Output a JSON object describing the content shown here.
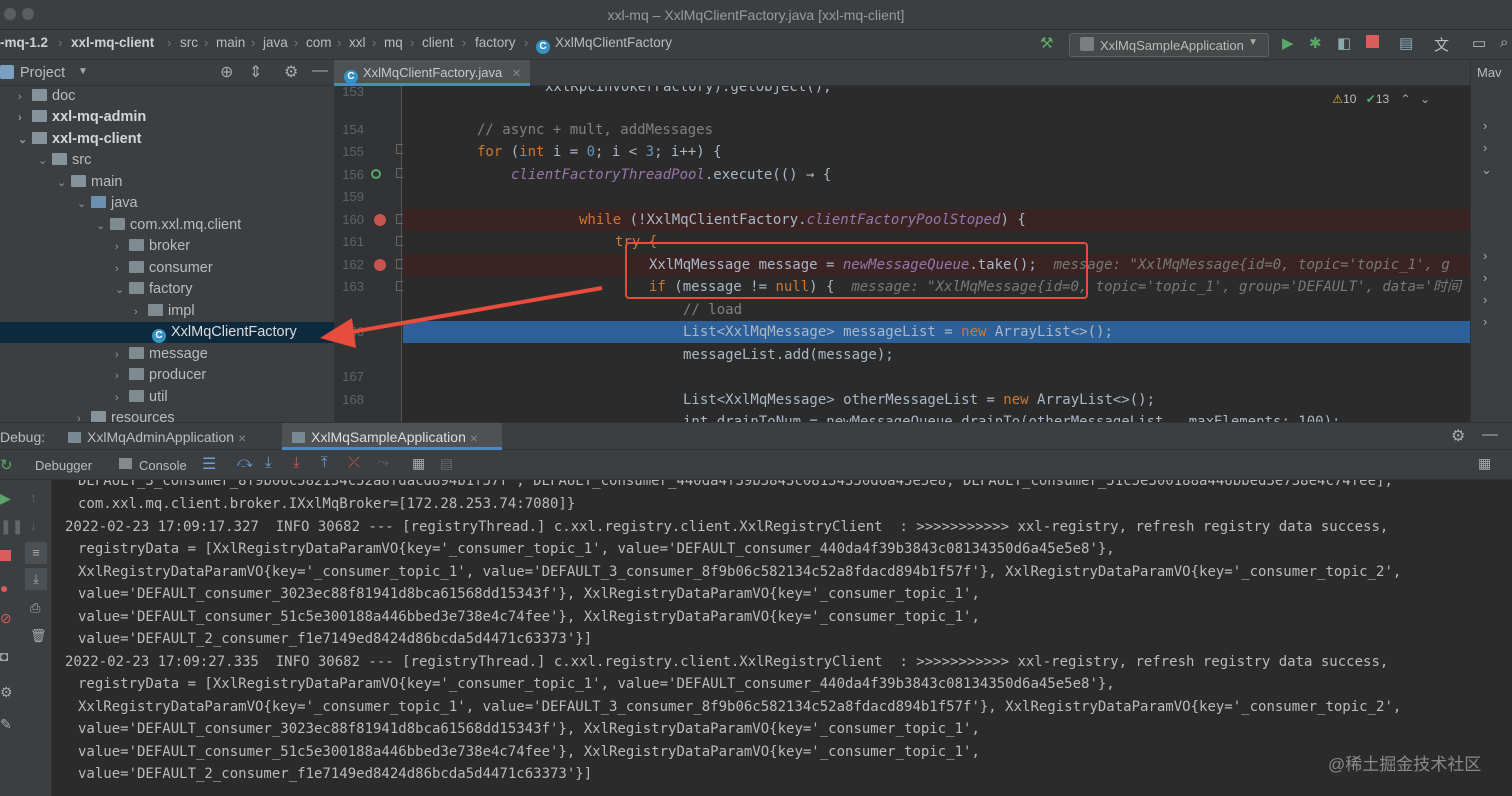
{
  "window": {
    "title": "xxl-mq – XxlMqClientFactory.java [xxl-mq-client]"
  },
  "breadcrumb": [
    "-mq-1.2",
    "xxl-mq-client",
    "src",
    "main",
    "java",
    "com",
    "xxl",
    "mq",
    "client",
    "factory",
    "XxlMqClientFactory"
  ],
  "run_config": "XxlMqSampleApplication",
  "project_panel": {
    "title": "Project"
  },
  "tree": [
    {
      "label": "doc",
      "bold": false
    },
    {
      "label": "xxl-mq-admin",
      "bold": true
    },
    {
      "label": "xxl-mq-client",
      "bold": true
    },
    {
      "label": "src",
      "bold": false
    },
    {
      "label": "main",
      "bold": false
    },
    {
      "label": "java",
      "bold": false
    },
    {
      "label": "com.xxl.mq.client",
      "bold": false
    },
    {
      "label": "broker",
      "bold": false
    },
    {
      "label": "consumer",
      "bold": false
    },
    {
      "label": "factory",
      "bold": false
    },
    {
      "label": "impl",
      "bold": false
    },
    {
      "label": "XxlMqClientFactory",
      "bold": false
    },
    {
      "label": "message",
      "bold": false
    },
    {
      "label": "producer",
      "bold": false
    },
    {
      "label": "util",
      "bold": false
    },
    {
      "label": "resources",
      "bold": false
    }
  ],
  "editor": {
    "tab": "XxlMqClientFactory.java",
    "warnings": "10",
    "checks": "13",
    "line_numbers": [
      "153",
      "154",
      "155",
      "156",
      "159",
      "160",
      "161",
      "162",
      "163",
      "",
      "166",
      "167",
      "168"
    ],
    "l153": "xxlRpcInvokerFactory).getObject();",
    "l154": "// async + mult, addMessages",
    "l155a": "for",
    "l155b": " (",
    "l155c": "int",
    "l155d": " i = ",
    "l155e": "0",
    "l155f": "; i < ",
    "l155g": "3",
    "l155h": "; i++) {",
    "l156a": "clientFactoryThreadPool",
    "l156b": ".execute(() → {",
    "l160a": "while",
    "l160b": " (!XxlMqClientFactory.",
    "l160c": "clientFactoryPoolStoped",
    "l160d": ") {",
    "l161": "try {",
    "l162a": "XxlMqMessage message = ",
    "l162b": "newMessageQueue",
    "l162c": ".take();",
    "l162hint": "message: \"XxlMqMessage{id=0, topic='topic_1', g",
    "l163a": "if",
    "l163b": " (message != ",
    "l163c": "null",
    "l163d": ") {",
    "l163hint": "message: \"XxlMqMessage{id=0, topic='topic_1', group='DEFAULT', data='时间",
    "l165": "// load",
    "l166a": "List<XxlMqMessage> messageList = ",
    "l166b": "new",
    "l166c": " ArrayList<>();",
    "l167": "messageList.add(message);",
    "l169a": "List<XxlMqMessage> otherMessageList = ",
    "l169b": "new",
    "l169c": " ArrayList<>();",
    "l170": "int drainToNum = newMessageQueue.drainTo(otherMessageList,  maxElements: 100);"
  },
  "debug": {
    "label": "Debug:",
    "tabs": [
      "XxlMqAdminApplication",
      "XxlMqSampleApplication"
    ],
    "toolbar": {
      "debugger": "Debugger",
      "console": "Console"
    }
  },
  "console_lines": [
    "DEFAULT_3_consumer_8f9b06c582134c52a8fdacd894b1f57f', DEFAULT_consumer_440da4f39b3843c08134350d6a45e5e8, DEFAULT_consumer_51c5e300188a446bbed3e738e4c74fee],",
    "com.xxl.mq.client.broker.IXxlMqBroker=[172.28.253.74:7080]}",
    "2022-02-23 17:09:17.327  INFO 30682 --- [registryThread.] c.xxl.registry.client.XxlRegistryClient  : >>>>>>>>>>> xxl-registry, refresh registry data success,",
    "registryData = [XxlRegistryDataParamVO{key='_consumer_topic_1', value='DEFAULT_consumer_440da4f39b3843c08134350d6a45e5e8'},",
    "XxlRegistryDataParamVO{key='_consumer_topic_1', value='DEFAULT_3_consumer_8f9b06c582134c52a8fdacd894b1f57f'}, XxlRegistryDataParamVO{key='_consumer_topic_2',",
    "value='DEFAULT_consumer_3023ec88f81941d8bca61568dd15343f'}, XxlRegistryDataParamVO{key='_consumer_topic_1',",
    "value='DEFAULT_consumer_51c5e300188a446bbed3e738e4c74fee'}, XxlRegistryDataParamVO{key='_consumer_topic_1',",
    "value='DEFAULT_2_consumer_f1e7149ed8424d86bcda5d4471c63373'}]",
    "2022-02-23 17:09:27.335  INFO 30682 --- [registryThread.] c.xxl.registry.client.XxlRegistryClient  : >>>>>>>>>>> xxl-registry, refresh registry data success,",
    "registryData = [XxlRegistryDataParamVO{key='_consumer_topic_1', value='DEFAULT_consumer_440da4f39b3843c08134350d6a45e5e8'},",
    "XxlRegistryDataParamVO{key='_consumer_topic_1', value='DEFAULT_3_consumer_8f9b06c582134c52a8fdacd894b1f57f'}, XxlRegistryDataParamVO{key='_consumer_topic_2',",
    "value='DEFAULT_consumer_3023ec88f81941d8bca61568dd15343f'}, XxlRegistryDataParamVO{key='_consumer_topic_1',",
    "value='DEFAULT_consumer_51c5e300188a446bbed3e738e4c74fee'}, XxlRegistryDataParamVO{key='_consumer_topic_1',",
    "value='DEFAULT_2_consumer_f1e7149ed8424d86bcda5d4471c63373'}]"
  ],
  "watermark": "@稀土掘金技术社区",
  "right_panel": {
    "label": "Mav"
  },
  "colors": {
    "accent": "#4a88c7",
    "annotation": "#e74c3c",
    "highlight_line": "#2d6099"
  }
}
